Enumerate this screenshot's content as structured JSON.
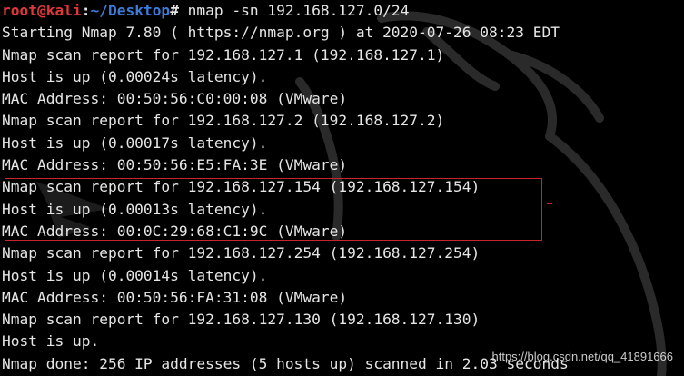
{
  "prompt": {
    "user": "root@kali",
    "separator": ":",
    "path": "~/Desktop",
    "symbol": "#",
    "command": " nmap -sn 192.168.127.0/24"
  },
  "output": [
    "Starting Nmap 7.80 ( https://nmap.org ) at 2020-07-26 08:23 EDT",
    "Nmap scan report for 192.168.127.1 (192.168.127.1)",
    "Host is up (0.00024s latency).",
    "MAC Address: 00:50:56:C0:00:08 (VMware)",
    "Nmap scan report for 192.168.127.2 (192.168.127.2)",
    "Host is up (0.00017s latency).",
    "MAC Address: 00:50:56:E5:FA:3E (VMware)",
    "Nmap scan report for 192.168.127.154 (192.168.127.154)",
    "Host is up (0.00013s latency).",
    "MAC Address: 00:0C:29:68:C1:9C (VMware)",
    "Nmap scan report for 192.168.127.254 (192.168.127.254)",
    "Host is up (0.00014s latency).",
    "MAC Address: 00:50:56:FA:31:08 (VMware)",
    "Nmap scan report for 192.168.127.130 (192.168.127.130)",
    "Host is up.",
    "Nmap done: 256 IP addresses (5 hosts up) scanned in 2.03 seconds"
  ],
  "watermark": "https://blog.csdn.net/qq_41891666",
  "colors": {
    "background": "#000000",
    "text": "#e6e6e6",
    "prompt_user": "#e0363a",
    "prompt_path": "#3d7bd9",
    "highlight_box": "#c8252f"
  },
  "icons": {
    "background": "kali-dragon-icon"
  }
}
